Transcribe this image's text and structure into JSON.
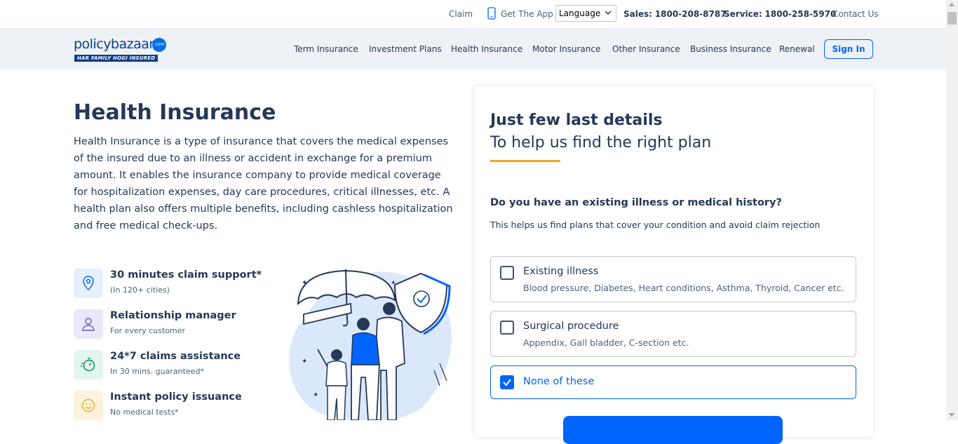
{
  "topbar": {
    "claim": "Claim",
    "get_app": "Get The App",
    "language": "Language",
    "sales_label": "Sales:",
    "sales_number": "1800-208-8787",
    "service_label": "Service:",
    "service_number": "1800-258-5970",
    "contact": "Contact Us"
  },
  "brand": {
    "name": "policybazaar",
    "dotcom": ".com",
    "tagline": "HAR FAMILY HOGI INSURED"
  },
  "nav": {
    "items": [
      "Term Insurance",
      "Investment Plans",
      "Health Insurance",
      "Motor Insurance",
      "Other Insurance",
      "Business Insurance",
      "Renewal"
    ],
    "signin": "Sign In"
  },
  "hero": {
    "title": "Health Insurance",
    "description": "Health Insurance is a type of insurance that covers the medical expenses of the insured due to an illness or accident in exchange for a premium amount. It enables the insurance company to provide medical coverage for hospitalization expenses, day care procedures, critical illnesses, etc. A health plan also offers multiple benefits, including cashless hospitalization and free medical check-ups."
  },
  "features": [
    {
      "title": "30 minutes claim support*",
      "sub": "(In 120+ cities)",
      "icon": "location-pin-icon",
      "bg": "#e6f0fc"
    },
    {
      "title": "Relationship manager",
      "sub": "For every customer",
      "icon": "person-icon",
      "bg": "#ece8fb"
    },
    {
      "title": "24*7 claims assistance",
      "sub": "In 30 mins. guaranteed*",
      "icon": "stopwatch-icon",
      "bg": "#e3f6ee"
    },
    {
      "title": "Instant policy issuance",
      "sub": "No medical tests*",
      "icon": "smiley-icon",
      "bg": "#fdf3dc"
    }
  ],
  "form": {
    "heading": "Just few last details",
    "subheading": "To help us find the right plan",
    "question": "Do you have an existing illness or medical history?",
    "question_sub": "This helps us find plans that cover your condition and avoid claim rejection",
    "options": [
      {
        "label": "Existing illness",
        "desc": "Blood pressure, Diabetes, Heart conditions, Asthma, Thyroid, Cancer etc.",
        "checked": false
      },
      {
        "label": "Surgical procedure",
        "desc": "Appendix, Gall bladder, C-section etc.",
        "checked": false
      },
      {
        "label": "None of these",
        "desc": "",
        "checked": true
      }
    ]
  },
  "colors": {
    "primary": "#0065ff",
    "text": "#253858",
    "accent": "#f5a623",
    "navbar_bg": "#eef1f5"
  }
}
